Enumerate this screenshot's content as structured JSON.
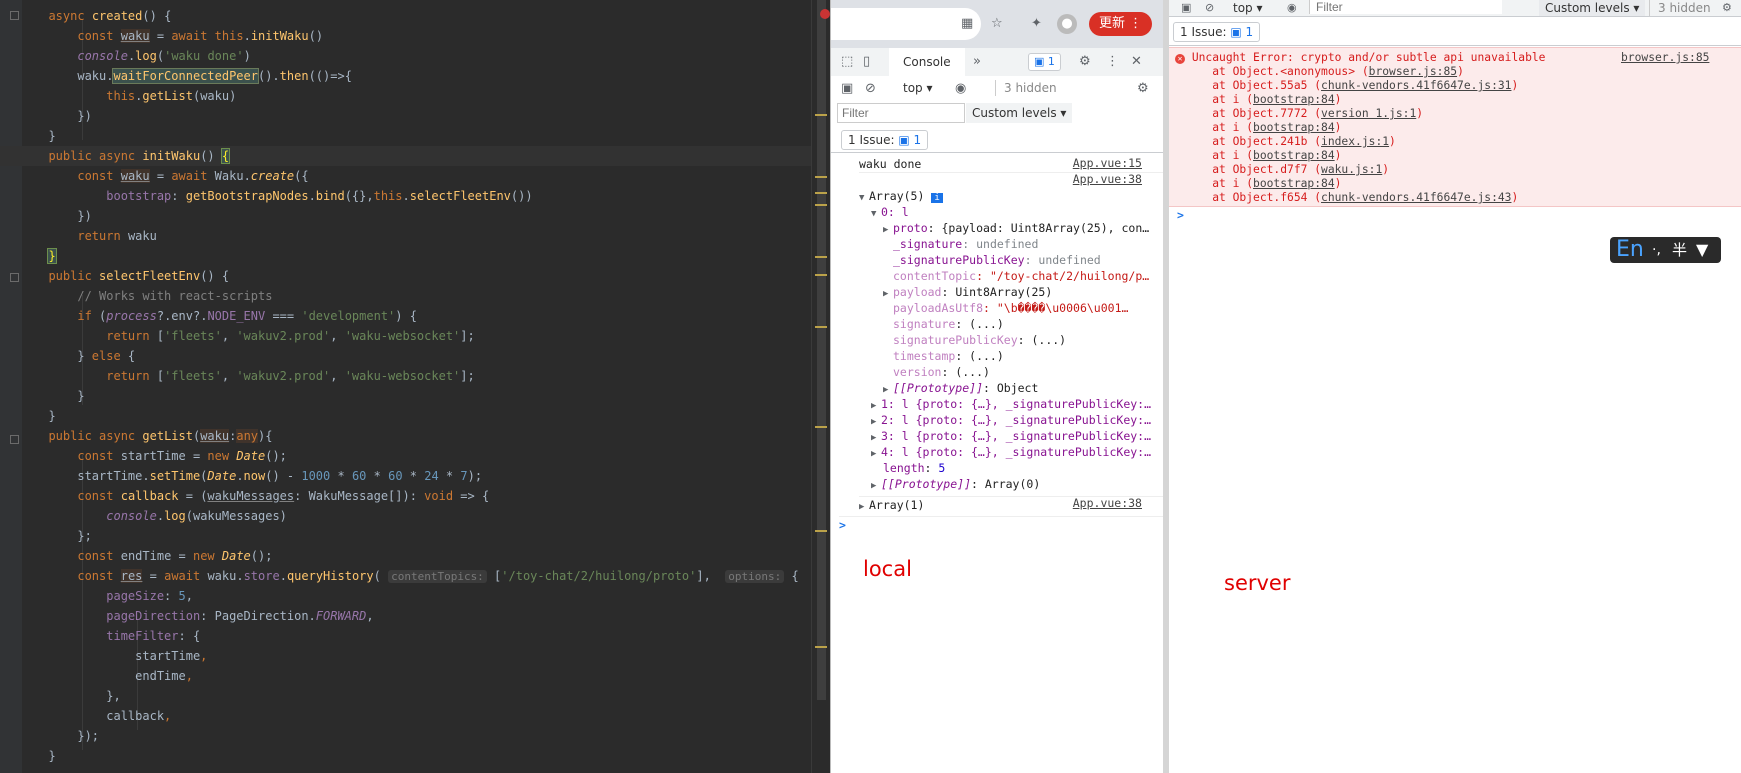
{
  "editor": {
    "lines": [
      [
        [
          "  ",
          ""
        ],
        [
          "async ",
          "kw"
        ],
        [
          "created",
          "fn"
        ],
        [
          "() {",
          ""
        ]
      ],
      [
        [
          "      ",
          ""
        ],
        [
          "const ",
          "kw"
        ],
        [
          "waku",
          "vhl u"
        ],
        [
          " = ",
          ""
        ],
        [
          "await ",
          "kw"
        ],
        [
          "this",
          "kw"
        ],
        [
          ".",
          ""
        ],
        [
          "initWaku",
          "fn"
        ],
        [
          "()",
          ""
        ]
      ],
      [
        [
          "      ",
          ""
        ],
        [
          "console",
          "prop it"
        ],
        [
          ".",
          ""
        ],
        [
          "log",
          "fn"
        ],
        [
          "(",
          ""
        ],
        [
          "'waku done'",
          "str"
        ],
        [
          ")",
          ""
        ]
      ],
      [
        [
          "      waku.",
          ""
        ],
        [
          "waitForConnectedPeer",
          "fn hl2"
        ],
        [
          "().",
          ""
        ],
        [
          "then",
          "fn"
        ],
        [
          "(()=>{",
          ""
        ]
      ],
      [
        [
          "          ",
          ""
        ],
        [
          "this",
          "kw"
        ],
        [
          ".",
          ""
        ],
        [
          "getList",
          "fn"
        ],
        [
          "(waku)",
          ""
        ]
      ],
      [
        [
          "      })",
          ""
        ]
      ],
      [
        [
          "  }",
          ""
        ]
      ],
      [
        [
          "  ",
          ""
        ],
        [
          "public ",
          "kw"
        ],
        [
          "async ",
          "kw"
        ],
        [
          "initWaku",
          "fn"
        ],
        [
          "() ",
          ""
        ],
        [
          "{",
          "brk"
        ]
      ],
      [
        [
          "      ",
          ""
        ],
        [
          "const ",
          "kw"
        ],
        [
          "waku",
          "vhl u"
        ],
        [
          " = ",
          ""
        ],
        [
          "await ",
          "kw"
        ],
        [
          "Waku.",
          ""
        ],
        [
          "create",
          "fn it"
        ],
        [
          "({",
          ""
        ]
      ],
      [
        [
          "          ",
          ""
        ],
        [
          "bootstrap",
          "prop"
        ],
        [
          ": ",
          ""
        ],
        [
          "getBootstrapNodes",
          "fn"
        ],
        [
          ".",
          ""
        ],
        [
          "bind",
          "fn"
        ],
        [
          "({},",
          ""
        ],
        [
          "this",
          "kw"
        ],
        [
          ".",
          ""
        ],
        [
          "selectFleetEnv",
          "fn"
        ],
        [
          "())",
          ""
        ]
      ],
      [
        [
          "      })",
          ""
        ]
      ],
      [
        [
          "      ",
          ""
        ],
        [
          "return ",
          "kw"
        ],
        [
          "waku",
          ""
        ]
      ],
      [
        [
          "  ",
          ""
        ],
        [
          "}",
          "brk"
        ]
      ],
      [
        [
          "  ",
          ""
        ],
        [
          "public ",
          "kw"
        ],
        [
          "selectFleetEnv",
          "fn"
        ],
        [
          "() {",
          ""
        ]
      ],
      [
        [
          "      ",
          ""
        ],
        [
          "// Works with react-scripts",
          "cmt"
        ]
      ],
      [
        [
          "      ",
          ""
        ],
        [
          "if ",
          "kw"
        ],
        [
          "(",
          ""
        ],
        [
          "process",
          "prop it"
        ],
        [
          "?.env?.",
          ""
        ],
        [
          "NODE_ENV",
          "prop"
        ],
        [
          " === ",
          ""
        ],
        [
          "'development'",
          "str"
        ],
        [
          ") {",
          ""
        ]
      ],
      [
        [
          "          ",
          ""
        ],
        [
          "return ",
          "kw"
        ],
        [
          "[",
          ""
        ],
        [
          "'fleets'",
          "str"
        ],
        [
          ", ",
          ""
        ],
        [
          "'wakuv2.prod'",
          "str"
        ],
        [
          ", ",
          ""
        ],
        [
          "'waku-websocket'",
          "str"
        ],
        [
          "];",
          ""
        ]
      ],
      [
        [
          "      } ",
          ""
        ],
        [
          "else ",
          "kw"
        ],
        [
          "{",
          ""
        ]
      ],
      [
        [
          "          ",
          ""
        ],
        [
          "return ",
          "kw"
        ],
        [
          "[",
          ""
        ],
        [
          "'fleets'",
          "str"
        ],
        [
          ", ",
          ""
        ],
        [
          "'wakuv2.prod'",
          "str"
        ],
        [
          ", ",
          ""
        ],
        [
          "'waku-websocket'",
          "str"
        ],
        [
          "];",
          ""
        ]
      ],
      [
        [
          "      }",
          ""
        ]
      ],
      [
        [
          "  }",
          ""
        ]
      ],
      [
        [
          "  ",
          ""
        ],
        [
          "public ",
          "kw"
        ],
        [
          "async ",
          "kw"
        ],
        [
          "getList",
          "fn"
        ],
        [
          "(",
          ""
        ],
        [
          "waku",
          "vhl u"
        ],
        [
          ":",
          ""
        ],
        [
          "any",
          "vhl kw"
        ],
        [
          "){",
          ""
        ]
      ],
      [
        [
          "      ",
          ""
        ],
        [
          "const ",
          "kw"
        ],
        [
          "startTime = ",
          ""
        ],
        [
          "new ",
          "kw"
        ],
        [
          "Date",
          "fn it"
        ],
        [
          "();",
          ""
        ]
      ],
      [
        [
          "      startTime.",
          ""
        ],
        [
          "setTime",
          "fn"
        ],
        [
          "(",
          ""
        ],
        [
          "Date",
          "fn it"
        ],
        [
          ".",
          ""
        ],
        [
          "now",
          "fn"
        ],
        [
          "() - ",
          ""
        ],
        [
          "1000",
          "num"
        ],
        [
          " * ",
          ""
        ],
        [
          "60",
          "num"
        ],
        [
          " * ",
          ""
        ],
        [
          "60",
          "num"
        ],
        [
          " * ",
          ""
        ],
        [
          "24",
          "num"
        ],
        [
          " * ",
          ""
        ],
        [
          "7",
          "num"
        ],
        [
          ");",
          ""
        ]
      ],
      [
        [
          "      ",
          ""
        ],
        [
          "const ",
          "kw"
        ],
        [
          "callback",
          "fn"
        ],
        [
          " = (",
          ""
        ],
        [
          "wakuMessages",
          "u"
        ],
        [
          ": WakuMessage[]): ",
          ""
        ],
        [
          "void ",
          "kw"
        ],
        [
          "=> {",
          ""
        ]
      ],
      [
        [
          "          ",
          ""
        ],
        [
          "console",
          "prop it"
        ],
        [
          ".",
          ""
        ],
        [
          "log",
          "fn"
        ],
        [
          "(wakuMessages)",
          ""
        ]
      ],
      [
        [
          "      };",
          ""
        ]
      ],
      [
        [
          "      ",
          ""
        ],
        [
          "const ",
          "kw"
        ],
        [
          "endTime = ",
          ""
        ],
        [
          "new ",
          "kw"
        ],
        [
          "Date",
          "fn it"
        ],
        [
          "();",
          ""
        ]
      ],
      [
        [
          "      ",
          ""
        ],
        [
          "const ",
          "kw"
        ],
        [
          "res",
          "u vhl"
        ],
        [
          " = ",
          ""
        ],
        [
          "await ",
          "kw"
        ],
        [
          "waku.",
          ""
        ],
        [
          "store",
          "prop"
        ],
        [
          ".",
          ""
        ],
        [
          "queryHistory",
          "fn"
        ],
        [
          "( ",
          ""
        ],
        [
          "contentTopics:",
          "hint"
        ],
        [
          " [",
          ""
        ],
        [
          "'/toy-chat/2/huilong/proto'",
          "str"
        ],
        [
          "],  ",
          ""
        ],
        [
          "options:",
          "hint"
        ],
        [
          " {",
          ""
        ]
      ],
      [
        [
          "          ",
          ""
        ],
        [
          "pageSize",
          "prop"
        ],
        [
          ": ",
          ""
        ],
        [
          "5",
          "num"
        ],
        [
          ",",
          ""
        ]
      ],
      [
        [
          "          ",
          ""
        ],
        [
          "pageDirection",
          "prop"
        ],
        [
          ": PageDirection.",
          ""
        ],
        [
          "FORWARD",
          "prop it"
        ],
        [
          ",",
          ""
        ]
      ],
      [
        [
          "          ",
          ""
        ],
        [
          "timeFilter",
          "prop"
        ],
        [
          ": {",
          ""
        ]
      ],
      [
        [
          "              startTime",
          ""
        ],
        [
          ",",
          "kw"
        ]
      ],
      [
        [
          "              endTime",
          ""
        ],
        [
          ",",
          "kw"
        ]
      ],
      [
        [
          "          },",
          ""
        ]
      ],
      [
        [
          "          callback",
          ""
        ],
        [
          ",",
          "kw"
        ]
      ],
      [
        [
          "      });",
          ""
        ]
      ],
      [
        [
          "  }",
          ""
        ]
      ],
      [
        [
          "",
          ""
        ]
      ]
    ]
  },
  "local": {
    "toolbar": {
      "console_tab": "Console",
      "issues_badge": "1",
      "more_tabs": "»"
    },
    "context": {
      "top": "top",
      "hidden": "3 hidden"
    },
    "filter": {
      "placeholder": "Filter",
      "levels": "Custom levels"
    },
    "issues": {
      "label": "1 Issue:",
      "count": "1"
    },
    "browser_bar": {
      "update_label": "更新"
    },
    "waku_done": "waku done",
    "src_app15": "App.vue:15",
    "src_app38": "App.vue:38",
    "src_app38b": "App.vue:38",
    "array5": "Array(5)",
    "item0": "0: l",
    "tree": [
      {
        "k": "proto",
        "v": ": {payload: Uint8Array(25), con…",
        "e": true,
        "c": "key"
      },
      {
        "k": "_signature",
        "v": ": undefined",
        "e": false,
        "c": "key",
        "vc": "uv"
      },
      {
        "k": "_signaturePublicKey",
        "v": ": undefined",
        "e": false,
        "c": "key",
        "vc": "uv"
      },
      {
        "k": "contentTopic",
        "v": ": \"/toy-chat/2/huilong/p…",
        "e": false,
        "c": "keyd",
        "vc": "sv"
      },
      {
        "k": "payload",
        "v": ": Uint8Array(25)",
        "e": true,
        "c": "keyd"
      },
      {
        "k": "payloadAsUtf8",
        "v": ": \"\\b����\\u0006\\u001…",
        "e": false,
        "c": "keyd",
        "vc": "sv"
      },
      {
        "k": "signature",
        "v": ": (...)",
        "e": false,
        "c": "keyd"
      },
      {
        "k": "signaturePublicKey",
        "v": ": (...)",
        "e": false,
        "c": "keyd"
      },
      {
        "k": "timestamp",
        "v": ": (...)",
        "e": false,
        "c": "keyd"
      },
      {
        "k": "version",
        "v": ": (...)",
        "e": false,
        "c": "keyd"
      },
      {
        "k": "[[Prototype]]",
        "v": ": Object",
        "e": true,
        "c": "key"
      }
    ],
    "items": [
      "1: l {proto: {…}, _signaturePublicKey:…",
      "2: l {proto: {…}, _signaturePublicKey:…",
      "3: l {proto: {…}, _signaturePublicKey:…",
      "4: l {proto: {…}, _signaturePublicKey:…"
    ],
    "length_key": "length",
    "length_val": "5",
    "proto_arr": "[[Prototype]]",
    "proto_arr_val": ": Array(0)",
    "array1": "Array(1)",
    "prompt": ">",
    "caption": "local"
  },
  "server": {
    "toolbar": {
      "top": "top",
      "filter_placeholder": "Filter",
      "levels": "Custom levels",
      "hidden": "3 hidden"
    },
    "issues": {
      "label": "1 Issue:",
      "count": "1"
    },
    "error": {
      "message": "Uncaught Error: crypto and/or subtle api unavailable",
      "source": "browser.js:85",
      "stack": [
        {
          "pre": "    at Object.<anonymous> (",
          "link": "browser.js:85",
          "post": ")"
        },
        {
          "pre": "    at Object.55a5 (",
          "link": "chunk-vendors.41f6647e.js:31",
          "post": ")"
        },
        {
          "pre": "    at i (",
          "link": "bootstrap:84",
          "post": ")"
        },
        {
          "pre": "    at Object.7772 (",
          "link": "version 1.js:1",
          "post": ")"
        },
        {
          "pre": "    at i (",
          "link": "bootstrap:84",
          "post": ")"
        },
        {
          "pre": "    at Object.241b (",
          "link": "index.js:1",
          "post": ")"
        },
        {
          "pre": "    at i (",
          "link": "bootstrap:84",
          "post": ")"
        },
        {
          "pre": "    at Object.d7f7 (",
          "link": "waku.js:1",
          "post": ")"
        },
        {
          "pre": "    at i (",
          "link": "bootstrap:84",
          "post": ")"
        },
        {
          "pre": "    at Object.f654 (",
          "link": "chunk-vendors.41f6647e.js:43",
          "post": ")"
        }
      ]
    },
    "prompt": ">",
    "caption": "server"
  },
  "ime": {
    "lang": "En",
    "punct": "·,",
    "width": "半"
  }
}
